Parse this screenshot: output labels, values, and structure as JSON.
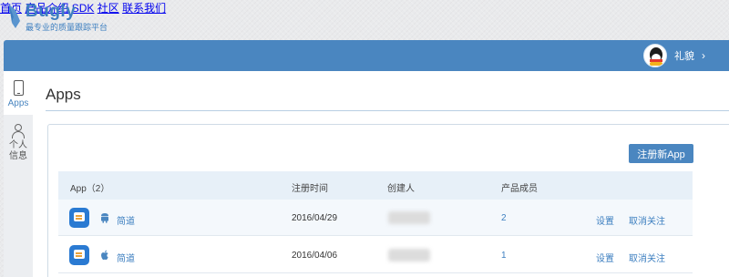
{
  "brand": {
    "name": "Bugly",
    "slogan": "最专业的质量跟踪平台",
    "accent": "#3d7fc0"
  },
  "nav": {
    "items": [
      "首页",
      "产品介绍",
      "SDK",
      "社区",
      "联系我们"
    ]
  },
  "user": {
    "name": "礼貌",
    "chevron": "›"
  },
  "sidebar": {
    "items": [
      {
        "label": "Apps",
        "icon": "phone-icon",
        "active": true
      },
      {
        "label_line1": "个人",
        "label_line2": "信息",
        "icon": "person-icon",
        "active": false
      }
    ]
  },
  "main": {
    "title": "Apps",
    "register_button": "注册新App"
  },
  "table": {
    "columns": [
      "App（2）",
      "注册时间",
      "创建人",
      "产品成员"
    ],
    "rows": [
      {
        "name": "简道",
        "platform": "android-icon",
        "date": "2016/04/29",
        "members": "2",
        "settings": "设置",
        "unfollow": "取消关注"
      },
      {
        "name": "简道",
        "platform": "apple-icon",
        "date": "2016/04/06",
        "members": "1",
        "settings": "设置",
        "unfollow": "取消关注"
      }
    ]
  },
  "colors": {
    "header_bar": "#4a86c0",
    "button": "#4a86c0",
    "table_header": "#e7f0f8",
    "link": "#3d7fc0"
  }
}
